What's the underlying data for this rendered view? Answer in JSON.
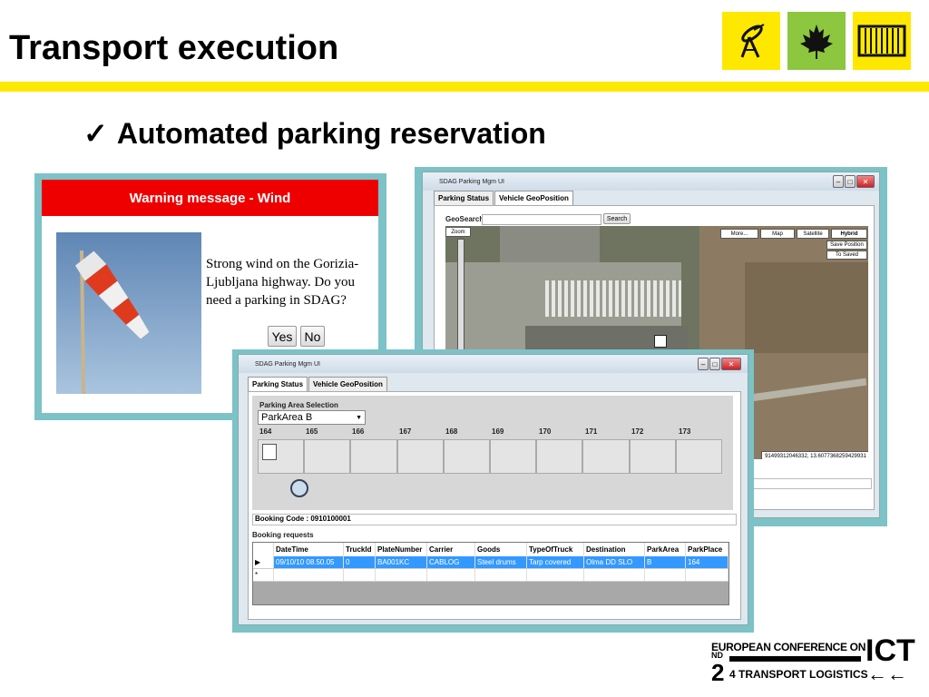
{
  "slide": {
    "title": "Transport execution",
    "bullet": "Automated parking reservation",
    "bullet_mark": "✓"
  },
  "logos": [
    {
      "name": "radar-dish-icon",
      "bg": "#ffe800"
    },
    {
      "name": "maple-leaf-icon",
      "bg": "#8dc63f"
    },
    {
      "name": "shipping-container-icon",
      "bg": "#ffe800"
    }
  ],
  "warning": {
    "header": "Warning message - Wind",
    "message": "Strong wind on the Gorizia-Ljubljana highway. Do you need a parking in SDAG?",
    "yes_label": "Yes",
    "no_label": "No"
  },
  "map_window": {
    "title": "SDAG Parking Mgm UI",
    "tabs": [
      "Parking Status",
      "Vehicle GeoPosition"
    ],
    "active_tab": "Vehicle GeoPosition",
    "geosearch_label": "GeoSearch",
    "search_button": "Search",
    "zoom_label": "Zoom",
    "map_buttons": [
      "More...",
      "Map",
      "Satellite",
      "Hybrid"
    ],
    "save_position": "Save Position",
    "to_saved": "To Saved",
    "coords": "91499312046332, 13.6077368259429931"
  },
  "parking_window": {
    "title": "SDAG Parking Mgm UI",
    "tabs": [
      "Parking Status",
      "Vehicle GeoPosition"
    ],
    "active_tab": "Parking Status",
    "area_selection_label": "Parking Area Selection",
    "area_selected": "ParkArea B",
    "places": [
      "164",
      "165",
      "166",
      "167",
      "168",
      "169",
      "170",
      "171",
      "172",
      "173"
    ],
    "booking_code_label": "Booking Code : 0910100001",
    "booking_requests_label": "Booking requests",
    "columns": [
      "DateTime",
      "TruckId",
      "PlateNumber",
      "Carrier",
      "Goods",
      "TypeOfTruck",
      "Destination",
      "ParkArea",
      "ParkPlace"
    ],
    "rows": [
      [
        "09/10/10 08.50.05",
        "0",
        "BA001KC",
        "CABLOG",
        "Steel drums",
        "Tarp covered",
        "Olma DD SLO",
        "B",
        "164"
      ]
    ],
    "new_row_marker": "*",
    "selected_row_marker": "▶"
  },
  "conference": {
    "line1": "EUROPEAN CONFERENCE ON",
    "ict": "ICT",
    "ordinal_num": "2",
    "ordinal_suffix": "ND",
    "line2": "4 TRANSPORT LOGISTICS",
    "arrows": "←←"
  }
}
